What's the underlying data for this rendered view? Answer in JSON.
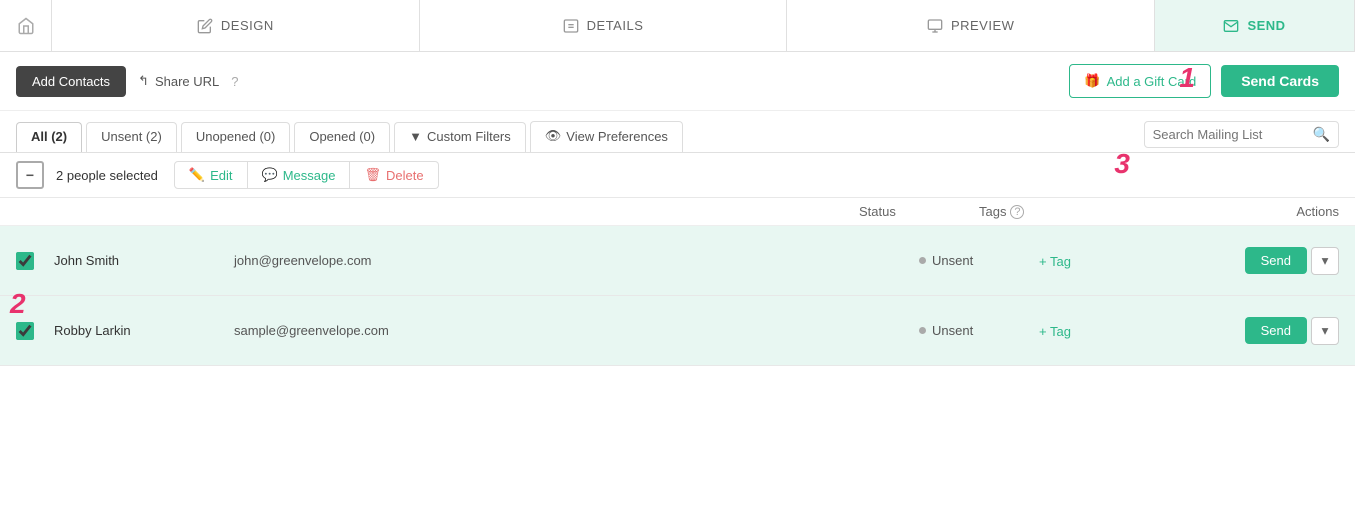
{
  "nav": {
    "home_icon": "🏠",
    "tabs": [
      {
        "id": "design",
        "label": "DESIGN",
        "icon": "✏️"
      },
      {
        "id": "details",
        "label": "DETAILS",
        "icon": "📄"
      },
      {
        "id": "preview",
        "label": "PREVIEW",
        "icon": "🖥️"
      },
      {
        "id": "send",
        "label": "SEND",
        "icon": "✉️",
        "active": true
      }
    ]
  },
  "toolbar": {
    "add_contacts_label": "Add Contacts",
    "share_url_label": "Share URL",
    "help_title": "?",
    "add_gift_label": "Add a Gift Card",
    "send_cards_label": "Send Cards"
  },
  "filters": {
    "tabs": [
      {
        "id": "all",
        "label": "All (2)",
        "active": true
      },
      {
        "id": "unsent",
        "label": "Unsent (2)"
      },
      {
        "id": "unopened",
        "label": "Unopened (0)"
      },
      {
        "id": "opened",
        "label": "Opened (0)"
      },
      {
        "id": "custom",
        "label": "Custom Filters"
      },
      {
        "id": "view",
        "label": "View Preferences"
      }
    ],
    "search_placeholder": "Search Mailing List"
  },
  "selection": {
    "minus_symbol": "−",
    "selected_text": "2 people selected",
    "edit_label": "Edit",
    "message_label": "Message",
    "delete_label": "Delete"
  },
  "table": {
    "col_status": "Status",
    "col_tags": "Tags",
    "col_actions": "Actions",
    "help_icon": "?"
  },
  "contacts": [
    {
      "id": 1,
      "name": "John Smith",
      "email": "john@greenvelope.com",
      "status": "Unsent",
      "tag_label": "+ Tag",
      "send_label": "Send",
      "checked": true
    },
    {
      "id": 2,
      "name": "Robby Larkin",
      "email": "sample@greenvelope.com",
      "status": "Unsent",
      "tag_label": "+ Tag",
      "send_label": "Send",
      "checked": true
    }
  ],
  "steps": {
    "step1": "1",
    "step2": "2",
    "step3": "3"
  },
  "colors": {
    "green": "#2db88a",
    "red_step": "#e8336d",
    "dark_btn": "#444"
  }
}
